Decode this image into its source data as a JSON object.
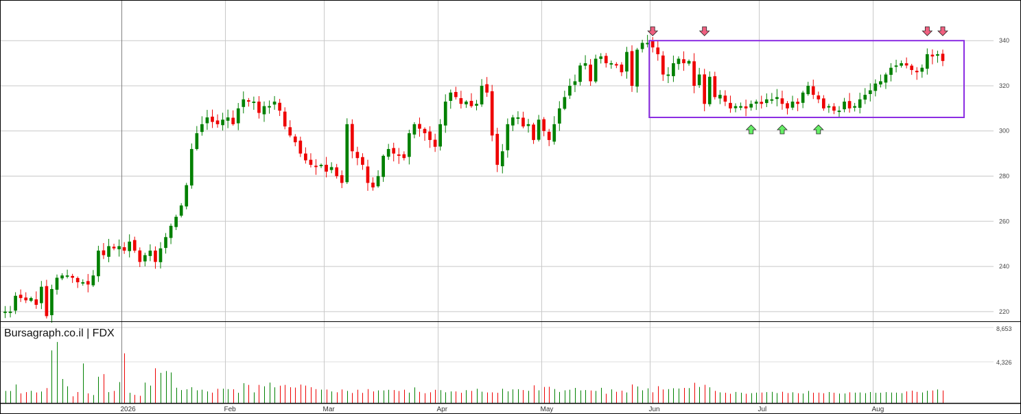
{
  "chart_data": [
    {
      "type": "candlestick",
      "ticker": "FDX",
      "watermark": "Bursagraph.co.il | FDX",
      "x_months": [
        "2026",
        "Feb",
        "Mar",
        "Apr",
        "May",
        "Jun",
        "Jul",
        "Aug"
      ],
      "y_ticks": [
        220,
        240,
        260,
        280,
        300,
        320,
        340
      ],
      "ylim": [
        216,
        358
      ],
      "grid": true,
      "up_color": "#008000",
      "down_color": "#ee0000",
      "range_box": {
        "top": 340,
        "bottom": 306,
        "color": "#8a2be2"
      },
      "sell_signals_color": "#f06080",
      "buy_signals_color": "#66ee66",
      "close": [
        220,
        220,
        227,
        226,
        225,
        226,
        223,
        231,
        218,
        230,
        235,
        236,
        236,
        235,
        233,
        233,
        232,
        236,
        247,
        245,
        249,
        248,
        249,
        247,
        251,
        247,
        242,
        245,
        247,
        242,
        248,
        253,
        258,
        262,
        267,
        276,
        292,
        299,
        303,
        306,
        304,
        303,
        305,
        306,
        303,
        310,
        314,
        313,
        313,
        308,
        311,
        311,
        313,
        309,
        302,
        298,
        295,
        290,
        287,
        285,
        284,
        285,
        282,
        284,
        280,
        277,
        303,
        291,
        288,
        285,
        277,
        275,
        280,
        289,
        292,
        290,
        289,
        288,
        299,
        303,
        301,
        299,
        296,
        293,
        303,
        313,
        317,
        315,
        312,
        313,
        311,
        312,
        320,
        317,
        298,
        285,
        291,
        303,
        306,
        306,
        302,
        303,
        296,
        305,
        300,
        296,
        303,
        310,
        315,
        320,
        322,
        329,
        330,
        322,
        332,
        333,
        330,
        330,
        329,
        326,
        335,
        320,
        336,
        339,
        339,
        337,
        334,
        325,
        325,
        330,
        332,
        330,
        331,
        320,
        325,
        312,
        324,
        315,
        316,
        313,
        310,
        311,
        311,
        310,
        312,
        313,
        312,
        314,
        314,
        315,
        312,
        310,
        313,
        312,
        317,
        320,
        316,
        314,
        310,
        311,
        309,
        309,
        313,
        310,
        311,
        314,
        316,
        318,
        321,
        322,
        325,
        328,
        329,
        330,
        329,
        327,
        326,
        328,
        334,
        333,
        334,
        331
      ],
      "volume": [
        1300,
        1290,
        2000,
        1040,
        1170,
        1310,
        1140,
        1240,
        1610,
        5670,
        6570,
        2590,
        1800,
        720,
        1180,
        4260,
        1040,
        860,
        2830,
        3120,
        1170,
        1300,
        2260,
        5350,
        1100,
        880,
        780,
        2200,
        1880,
        3740,
        3250,
        3450,
        3290,
        1650,
        1400,
        1480,
        1700,
        1370,
        1430,
        1250,
        1120,
        1530,
        1540,
        1500,
        1480,
        1100,
        2140,
        1950,
        1150,
        1950,
        1800,
        2200,
        1690,
        1870,
        1950,
        1700,
        1660,
        1990,
        1880,
        1700,
        1500,
        1440,
        1450,
        1250,
        1160,
        1460,
        1300,
        1080,
        1430,
        1090,
        1500,
        1250,
        1360,
        1360,
        1420,
        1400,
        1290,
        1430,
        1120,
        1680,
        1200,
        1050,
        1160,
        1420,
        1390,
        1160,
        1250,
        1250,
        1100,
        1390,
        1300,
        1530,
        1220,
        1140,
        1150,
        1100,
        1530,
        1260,
        1470,
        1490,
        1400,
        1310,
        1900,
        1370,
        1730,
        1750,
        1510,
        1190,
        1370,
        1430,
        1630,
        1360,
        1400,
        1350,
        1300,
        1640,
        1000,
        1470,
        1210,
        1330,
        1140,
        2000,
        1780,
        1370,
        1580,
        1160,
        1810,
        1460,
        1500,
        1590,
        1560,
        1630,
        1610,
        2180,
        1730,
        1960,
        1690,
        1300,
        1150,
        1110,
        1000,
        1190,
        1110,
        1000,
        1060,
        1120,
        1130,
        1170,
        1200,
        1070,
        1210,
        1070,
        1160,
        1050,
        1030,
        1300,
        1110,
        1120,
        1050,
        1180,
        1110,
        1020,
        1030,
        1160,
        1120,
        1140,
        1060,
        1180,
        1100,
        1110,
        1170,
        1130,
        1120,
        1060,
        1250,
        1330,
        1200,
        1140,
        1320,
        1350,
        1460,
        1350,
        1220,
        1460,
        1080,
        1170,
        1210,
        1080
      ]
    }
  ]
}
